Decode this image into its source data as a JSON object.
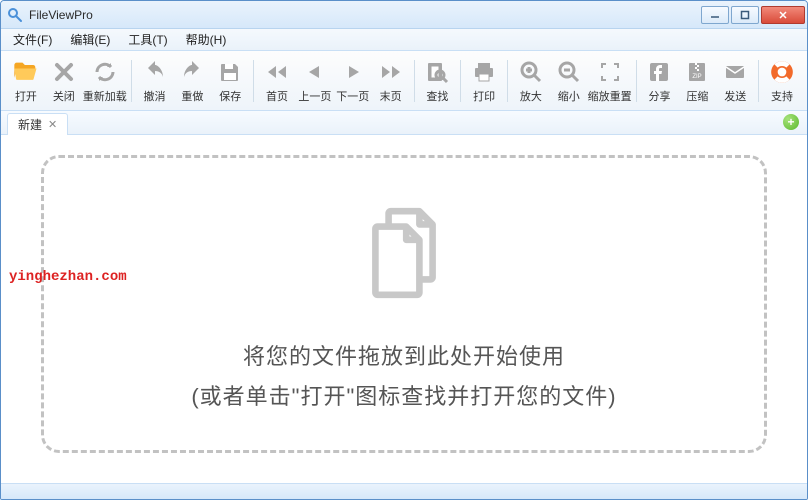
{
  "window": {
    "title": "FileViewPro"
  },
  "menu": {
    "file": "文件(F)",
    "edit": "编辑(E)",
    "tools": "工具(T)",
    "help": "帮助(H)"
  },
  "toolbar": {
    "open": "打开",
    "close": "关闭",
    "reload": "重新加载",
    "undo": "撤消",
    "redo": "重做",
    "save": "保存",
    "first": "首页",
    "prev": "上一页",
    "next": "下一页",
    "last": "末页",
    "find": "查找",
    "print": "打印",
    "zoomin": "放大",
    "zoomout": "缩小",
    "zoomreset": "缩放重置",
    "share": "分享",
    "zip": "压缩",
    "send": "发送",
    "support": "支持"
  },
  "tabs": {
    "new": "新建"
  },
  "dropzone": {
    "line1": "将您的文件拖放到此处开始使用",
    "line2": "(或者单击\"打开\"图标查找并打开您的文件)"
  },
  "watermark": "yinghezhan.com"
}
